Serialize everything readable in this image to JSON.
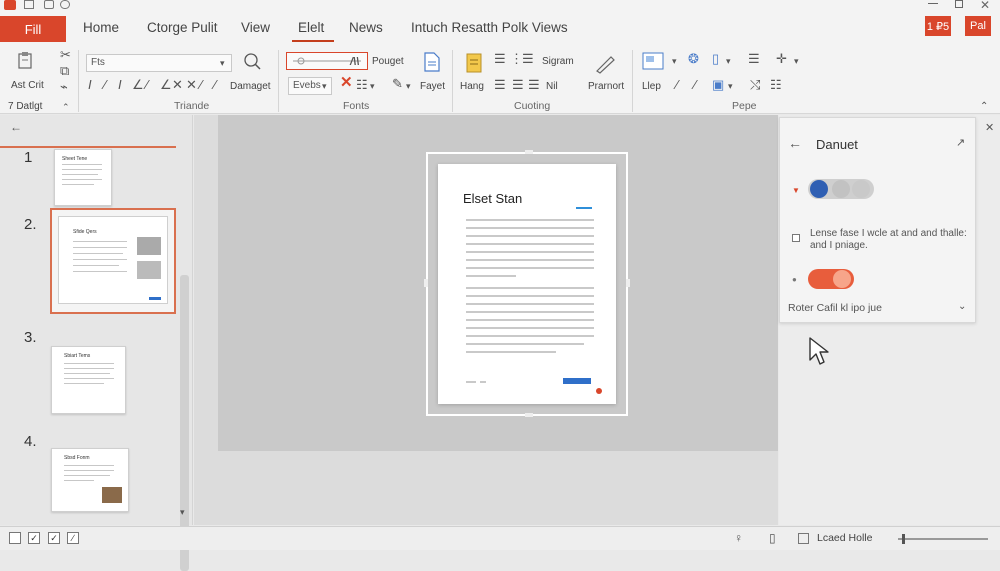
{
  "titlebar": {
    "file_tab": "Fill",
    "tabs": [
      "Home",
      "Ctorge Pulit",
      "View",
      "Elelt",
      "News",
      "Intuch Resatth Polk Views"
    ],
    "window_buttons": [
      "1 ₽5",
      "Pal"
    ]
  },
  "ribbon": {
    "groups": [
      "Triande",
      "Fonts",
      "Cuoting",
      "Pepe"
    ],
    "clipboard": {
      "label": "Ast Crit",
      "sub": "7 Datlgt"
    },
    "font_box": "Fts",
    "damaget": "Damaget",
    "style_box": "Evebs",
    "pouget": "Pouget",
    "fayet": "Fayet",
    "hang": "Hang",
    "sigram": "Sigram",
    "mi": "Nil",
    "prarnort": "Prarnort",
    "llep": "Llep"
  },
  "slides": {
    "numbers": [
      "1",
      "2.",
      "3.",
      "4."
    ],
    "titles": [
      "Sheet Tene",
      "Sfide Qers",
      "Sbiart Tems",
      "Sbsd Fonm"
    ]
  },
  "page": {
    "title": "Elset Stan"
  },
  "panel": {
    "title": "Danuet",
    "checkbox_text": "Lense fase I wcle at and and thalle: and I pniage.",
    "dropdown_text": "Roter Cafil kl ipo jue",
    "toggle1_on": false,
    "toggle2_on": true
  },
  "status": {
    "zoom_label": "Lcaed Holle"
  },
  "colors": {
    "accent": "#d9462b",
    "toggle_blue": "#2f5fb3",
    "toggle_orange": "#e85d3c"
  }
}
